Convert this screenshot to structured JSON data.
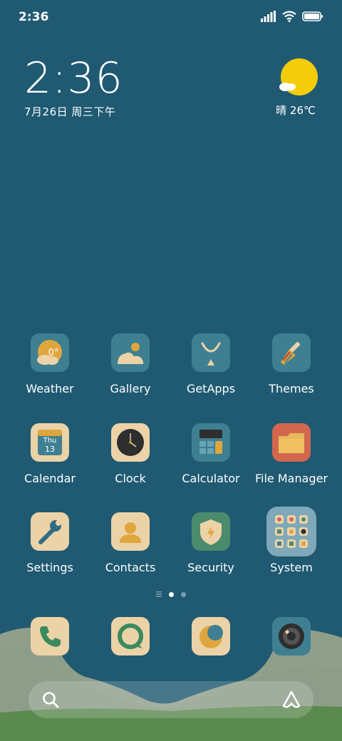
{
  "status_bar": {
    "time": "2:36"
  },
  "clock_widget": {
    "time": "2:36",
    "date": "7月26日 周三下午"
  },
  "weather_widget": {
    "text": "晴 26℃",
    "icon": "sun-cloud-icon"
  },
  "apps": [
    {
      "label": "Weather",
      "icon": "weather-icon",
      "detail": "0°"
    },
    {
      "label": "Gallery",
      "icon": "gallery-icon"
    },
    {
      "label": "GetApps",
      "icon": "getapps-icon"
    },
    {
      "label": "Themes",
      "icon": "brush-icon"
    },
    {
      "label": "Calendar",
      "icon": "calendar-icon",
      "detail_day": "Thu",
      "detail_date": "13"
    },
    {
      "label": "Clock",
      "icon": "clock-icon"
    },
    {
      "label": "Calculator",
      "icon": "calculator-icon"
    },
    {
      "label": "File Manager",
      "icon": "folder-icon"
    },
    {
      "label": "Settings",
      "icon": "wrench-icon"
    },
    {
      "label": "Contacts",
      "icon": "person-icon"
    },
    {
      "label": "Security",
      "icon": "shield-icon"
    },
    {
      "label": "System",
      "icon": "folder-grid-icon"
    }
  ],
  "page_indicator": {
    "pages": 2,
    "current": 1
  },
  "dock": [
    {
      "name": "phone",
      "icon": "phone-icon"
    },
    {
      "name": "messages",
      "icon": "message-icon"
    },
    {
      "name": "browser",
      "icon": "browser-icon"
    },
    {
      "name": "camera",
      "icon": "camera-icon"
    }
  ],
  "search": {
    "icon": "search-icon",
    "assistant_icon": "assistant-icon"
  },
  "colors": {
    "background": "#1f5a72",
    "icon_cream": "#ecd2a7",
    "icon_teal": "#3f7f92",
    "accent_orange": "#e0a63e",
    "sun_yellow": "#f4cd0a"
  }
}
